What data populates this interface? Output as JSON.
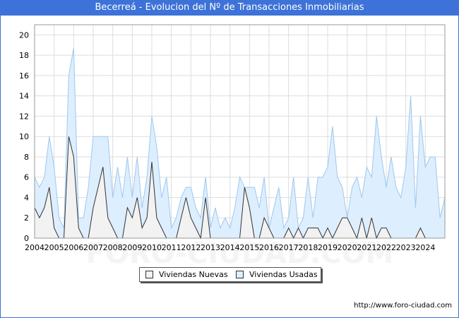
{
  "header": {
    "title": "Becerreá - Evolucion del Nº de Transacciones Inmobiliarias"
  },
  "footer": {
    "url": "http://www.foro-ciudad.com"
  },
  "watermark": "FORO-CIUDAD.COM",
  "chart_data": {
    "type": "area",
    "title": "Becerreá - Evolucion del Nº de Transacciones Inmobiliarias",
    "x_start": 2004,
    "x_end": 2025,
    "xticks": [
      "2004",
      "2005",
      "2006",
      "2007",
      "2008",
      "2009",
      "2010",
      "2011",
      "2012",
      "2013",
      "2014",
      "2015",
      "2016",
      "2017",
      "2018",
      "2019",
      "2020",
      "2021",
      "2022",
      "2023",
      "2024"
    ],
    "ylim": [
      0,
      21
    ],
    "yticks": [
      0,
      2,
      4,
      6,
      8,
      10,
      12,
      14,
      16,
      18,
      20
    ],
    "grid": true,
    "legend_position": "bottom",
    "series": [
      {
        "name": "Viviendas Nuevas",
        "color": "#f2f2f2",
        "stroke": "#333333",
        "values": [
          3,
          2,
          3,
          5,
          1,
          0,
          0,
          10,
          8,
          1,
          0,
          0,
          3,
          5,
          7,
          2,
          1,
          0,
          0,
          3,
          2,
          4,
          1,
          2,
          7.5,
          2,
          1,
          0,
          0,
          0,
          2,
          4,
          2,
          1,
          0,
          4,
          0,
          0,
          0,
          0,
          0,
          0,
          0,
          5,
          3,
          0,
          0,
          2,
          1,
          0,
          0,
          0,
          1,
          0,
          1,
          0,
          1,
          1,
          1,
          0,
          1,
          0,
          1,
          2,
          2,
          1,
          0,
          2,
          0,
          2,
          0,
          1,
          1,
          0,
          0,
          0,
          0,
          0,
          0,
          1,
          0,
          0,
          0,
          0,
          0
        ]
      },
      {
        "name": "Viviendas Usadas",
        "color": "#ddeeff",
        "stroke": "#9ec8ee",
        "values": [
          6,
          5,
          6,
          10,
          7,
          2,
          1,
          16,
          18.7,
          2,
          2,
          5,
          10,
          10,
          10,
          10,
          4,
          7,
          4,
          8,
          4,
          8,
          3,
          6,
          12,
          9,
          4,
          6,
          1,
          2,
          4,
          5,
          5,
          3,
          2,
          6,
          1,
          3,
          1,
          2,
          1,
          3,
          6,
          5,
          5,
          5,
          3,
          6,
          1,
          3,
          5,
          1,
          2,
          6,
          1,
          2,
          6,
          2,
          6,
          6,
          7,
          11,
          6,
          5,
          2,
          5,
          6,
          4,
          7,
          6,
          12,
          8,
          5,
          8,
          5,
          4,
          7,
          14,
          3,
          12,
          7,
          8,
          8,
          2,
          4
        ]
      }
    ]
  }
}
